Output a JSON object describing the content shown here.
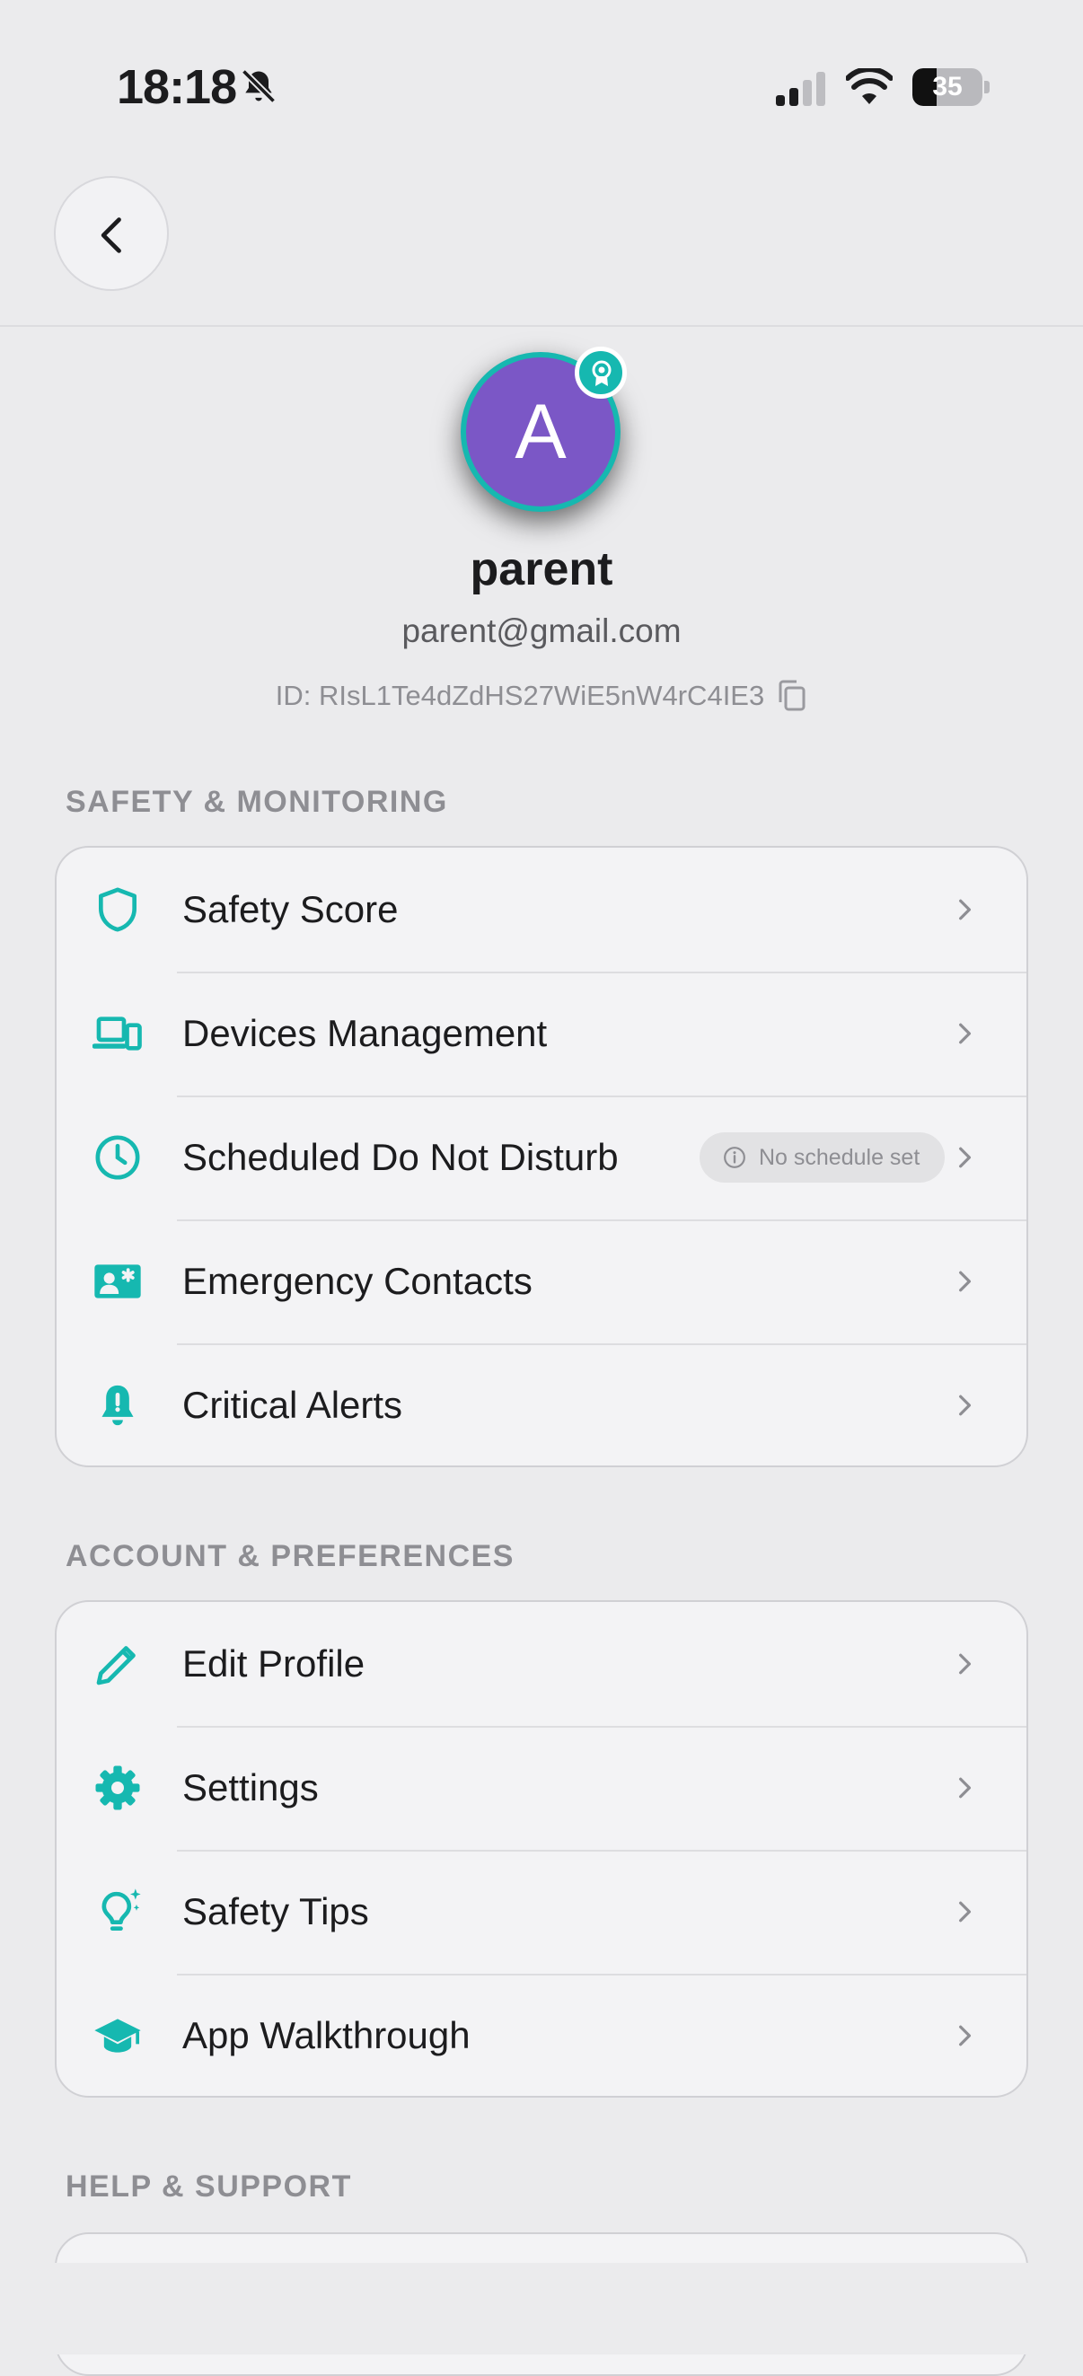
{
  "status_bar": {
    "time": "18:18",
    "battery": "35",
    "battery_level": 0.35
  },
  "profile": {
    "avatar_initial": "A",
    "name": "parent",
    "email": "parent@gmail.com",
    "user_id": "ID: RIsL1Te4dZdHS27WiE5nW4rC4IE3"
  },
  "sections": {
    "safety": {
      "title": "SAFETY & MONITORING",
      "items": [
        {
          "label": "Safety Score",
          "icon": "shield-icon"
        },
        {
          "label": "Devices Management",
          "icon": "devices-icon"
        },
        {
          "label": "Scheduled Do Not Disturb",
          "icon": "clock-icon",
          "chip": "No schedule set"
        },
        {
          "label": "Emergency Contacts",
          "icon": "contact-card-icon"
        },
        {
          "label": "Critical Alerts",
          "icon": "alert-bell-icon"
        }
      ]
    },
    "account": {
      "title": "ACCOUNT & PREFERENCES",
      "items": [
        {
          "label": "Edit Profile",
          "icon": "pencil-icon"
        },
        {
          "label": "Settings",
          "icon": "gear-icon"
        },
        {
          "label": "Safety Tips",
          "icon": "lightbulb-icon"
        },
        {
          "label": "App Walkthrough",
          "icon": "graduation-cap-icon"
        }
      ]
    },
    "help": {
      "title": "HELP & SUPPORT"
    }
  },
  "colors": {
    "accent": "#16b8b0",
    "avatar": "#7b57c6",
    "background": "#ebebed",
    "card": "#f3f3f5"
  }
}
